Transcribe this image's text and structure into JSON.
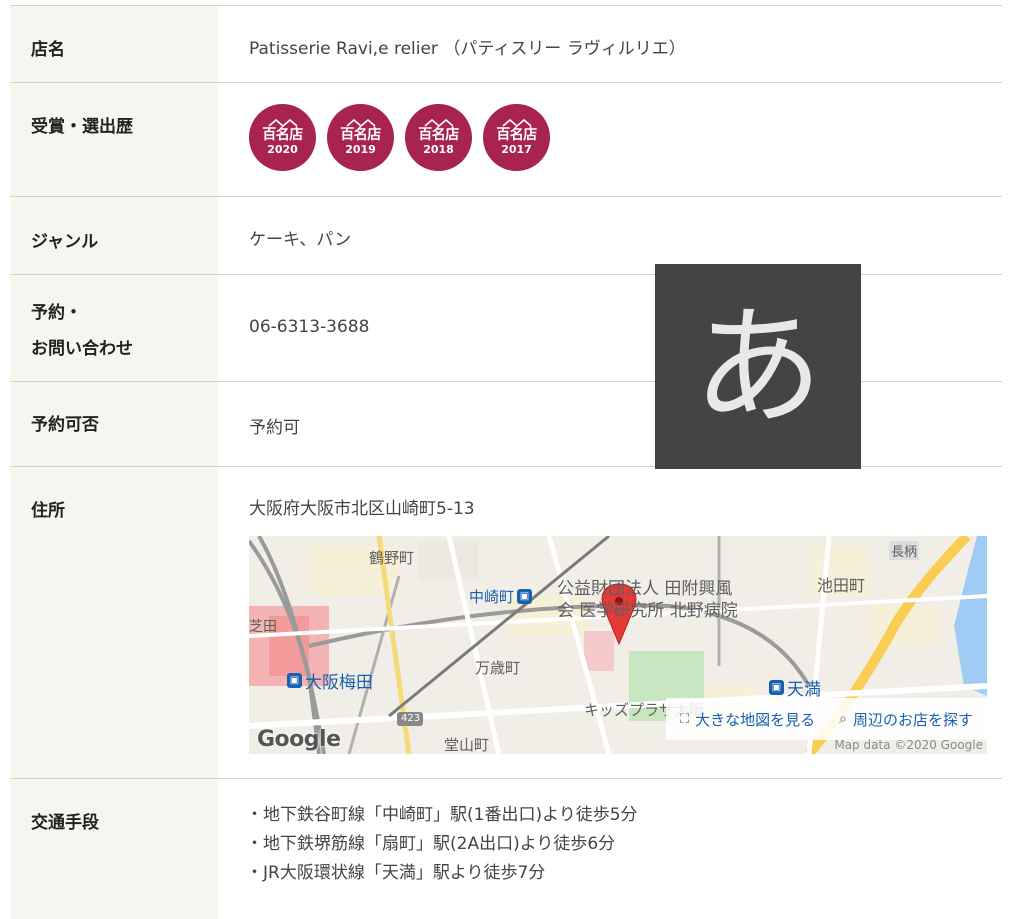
{
  "rows": {
    "name": {
      "label": "店名",
      "value": "Patisserie Ravi,e relier （パティスリー ラヴィルリエ）"
    },
    "awards": {
      "label": "受賞・選出歴",
      "badges": [
        {
          "title": "百名店",
          "year": "2020"
        },
        {
          "title": "百名店",
          "year": "2019"
        },
        {
          "title": "百名店",
          "year": "2018"
        },
        {
          "title": "百名店",
          "year": "2017"
        }
      ]
    },
    "genre": {
      "label": "ジャンル",
      "value": "ケーキ、パン"
    },
    "reservation_contact": {
      "label_line1": "予約・",
      "label_line2": "お問い合わせ",
      "value": "06-6313-3688"
    },
    "reservation": {
      "label": "予約可否",
      "value": "予約可"
    },
    "address": {
      "label": "住所",
      "value": "大阪府大阪市北区山崎町5-13"
    },
    "access": {
      "label": "交通手段",
      "lines": [
        "・地下鉄谷町線「中崎町」駅(1番出口)より徒歩5分",
        "・地下鉄堺筋線「扇町」駅(2A出口)より徒歩6分",
        "・JR大阪環状線「天満」駅より徒歩7分"
      ]
    }
  },
  "map": {
    "labels": {
      "tsuruno": "鶴野町",
      "chofu": "長柄",
      "ikeda": "池田町",
      "koueki": "公益財団法人 田附興風",
      "kenkyu": "会 医学研究所 北野病院",
      "shiba": "芝田",
      "manzai": "万歳町",
      "kids": "キッズプラザ大阪",
      "doyama": "堂山町",
      "route": "423"
    },
    "stations": {
      "nakazaki": "中崎町",
      "umeda": "大阪梅田",
      "tenma": "天満"
    },
    "controls": {
      "large_map": "大きな地図を見る",
      "nearby": "周辺のお店を探す"
    },
    "attribution": "Map data ©2020 Google",
    "logo": "Google"
  },
  "ime": {
    "char": "あ"
  },
  "colors": {
    "badge": "#a8234f",
    "header_bg": "#f7f5f0",
    "border": "#d9d2bd",
    "pin": "#e53935"
  }
}
